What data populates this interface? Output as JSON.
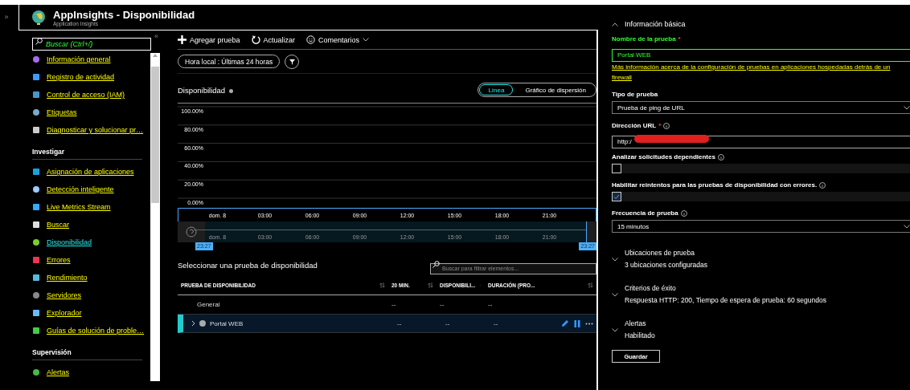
{
  "rail": {
    "expand": "»"
  },
  "header": {
    "title": "AppInsights - Disponibilidad",
    "subtitle": "Application Insights"
  },
  "sidebar": {
    "search": {
      "placeholder": "Buscar (Ctrl+/)"
    },
    "collapse": "«",
    "sections": [
      {
        "items": [
          {
            "label": "Información general",
            "selected": false
          },
          {
            "label": "Registro de actividad",
            "selected": false
          },
          {
            "label": "Control de acceso (IAM)",
            "selected": false
          },
          {
            "label": "Etiquetas",
            "selected": false
          },
          {
            "label": "Diagnosticar y solucionar pr…",
            "selected": false
          }
        ]
      },
      {
        "title": "Investigar",
        "items": [
          {
            "label": "Asignación de aplicaciones",
            "selected": false
          },
          {
            "label": "Detección inteligente",
            "selected": false
          },
          {
            "label": "Live Metrics Stream",
            "selected": false
          },
          {
            "label": "Buscar",
            "selected": false
          },
          {
            "label": "Disponibilidad",
            "selected": true
          },
          {
            "label": "Errores",
            "selected": false
          },
          {
            "label": "Rendimiento",
            "selected": false
          },
          {
            "label": "Servidores",
            "selected": false
          },
          {
            "label": "Explorador",
            "selected": false
          },
          {
            "label": "Guías de solución de proble…",
            "selected": false
          }
        ]
      },
      {
        "title": "Supervisión",
        "items": [
          {
            "label": "Alertas",
            "selected": false
          }
        ]
      }
    ]
  },
  "toolbar": {
    "buttons": [
      {
        "label": "Agregar prueba",
        "kind": "add"
      },
      {
        "label": "Actualizar",
        "kind": "refresh"
      },
      {
        "label": "Comentarios",
        "kind": "feedback"
      }
    ]
  },
  "time_filter": {
    "label": "Hora local : Últimas 24 horas"
  },
  "chart_panel": {
    "title": "Disponibilidad",
    "views": [
      {
        "label": "Línea",
        "selected": true
      },
      {
        "label": "Gráfico de dispersión",
        "selected": false
      }
    ],
    "chart_data": {
      "type": "line",
      "grid": true,
      "categories": [
        "dom. 8",
        "03:00",
        "06:00",
        "09:00",
        "12:00",
        "15:00",
        "18:00",
        "21:00"
      ],
      "ylim": [
        0,
        100
      ],
      "yticks": [
        {
          "value": 100,
          "label": "100.00%"
        },
        {
          "value": 80,
          "label": "80.00%"
        },
        {
          "value": 60,
          "label": "60.00%"
        },
        {
          "value": 40,
          "label": "40.00%"
        },
        {
          "value": 20,
          "label": "20.00%"
        },
        {
          "value": 0,
          "label": "0.00%"
        }
      ]
    },
    "brush": {
      "labels": [
        "dom. 8",
        "03:00",
        "06:00",
        "09:00",
        "12:00",
        "15:00",
        "18:00",
        "21:00"
      ],
      "start": "23:27",
      "end": "23:27"
    }
  },
  "tests": {
    "title": "Seleccionar una prueba de disponibilidad",
    "search": {
      "placeholder": "Buscar para filtrar elementos..."
    },
    "columns": [
      "PRUEBA DE DISPONIBILIDAD",
      "20 MIN.",
      "DISPONIBILI...",
      "DURACIÓN (PRO..."
    ],
    "rows": [
      {
        "kind": "group",
        "cells": [
          "General",
          "--",
          "--",
          "--"
        ],
        "selected": false
      },
      {
        "kind": "test",
        "cells": [
          "Portal WEB",
          "--",
          "--",
          "--"
        ],
        "selected": true
      }
    ]
  },
  "form": {
    "section": {
      "title": "Información básica",
      "expanded": true
    },
    "fields": [
      {
        "kind": "text",
        "label": "Nombre de la prueba",
        "required_mark": "*",
        "value": "Portal WEB",
        "focused": true
      },
      {
        "kind": "link",
        "text": "Más información acerca de la configuración de pruebas en aplicaciones hospedadas detrás de un firewall"
      },
      {
        "kind": "select",
        "label": "Tipo de prueba",
        "value": "Prueba de ping de URL"
      },
      {
        "kind": "text",
        "label": "Dirección URL",
        "required_mark": "*",
        "info": true,
        "value": "http:/",
        "redacted": true
      },
      {
        "kind": "checkbox",
        "label": "Analizar solicitudes dependientes",
        "info": true,
        "checked": false
      },
      {
        "kind": "checkbox",
        "label": "Habilitar reintentos para las pruebas de disponibilidad con errores.",
        "info": true,
        "checked": true
      },
      {
        "kind": "select",
        "label": "Frecuencia de prueba",
        "info": true,
        "value": "15 minutos"
      }
    ],
    "groups": [
      {
        "title": "Ubicaciones de prueba",
        "summary": "3 ubicaciones configuradas",
        "expanded": false
      },
      {
        "title": "Criterios de éxito",
        "summary": "Respuesta HTTP: 200, Tiempo de espera de prueba: 60 segundos",
        "expanded": false
      },
      {
        "title": "Alertas",
        "summary": "Habilitado",
        "expanded": false
      }
    ],
    "save": "Guardar"
  }
}
